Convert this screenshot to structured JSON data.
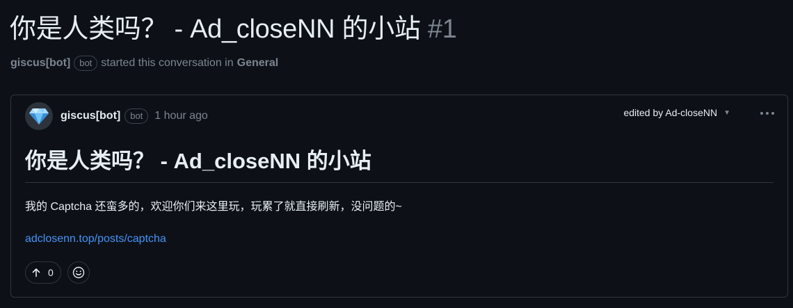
{
  "discussion": {
    "title": "你是人类吗？ - Ad_closeNN 的小站",
    "number": "#1",
    "author": "giscus[bot]",
    "author_badge": "bot",
    "started_text": "started this conversation in",
    "category": "General"
  },
  "post": {
    "author": "giscus[bot]",
    "author_badge": "bot",
    "time": "1 hour ago",
    "edited_text": "edited by Ad-closeNN",
    "title": "你是人类吗？ - Ad_closeNN 的小站",
    "body": "我的 Captcha 还蛮多的，欢迎你们来这里玩，玩累了就直接刷新，没问题的~",
    "link": "adclosenn.top/posts/captcha",
    "upvote_count": "0",
    "more_icon": "kebab-horizontal-icon",
    "avatar_icon": "diamond-icon",
    "upvote_icon": "arrow-up-icon",
    "reaction_icon": "smiley-icon"
  },
  "colors": {
    "background": "#0d1117",
    "border": "#30363d",
    "text": "#e6edf3",
    "muted": "#7d8590",
    "link": "#4493f8"
  }
}
